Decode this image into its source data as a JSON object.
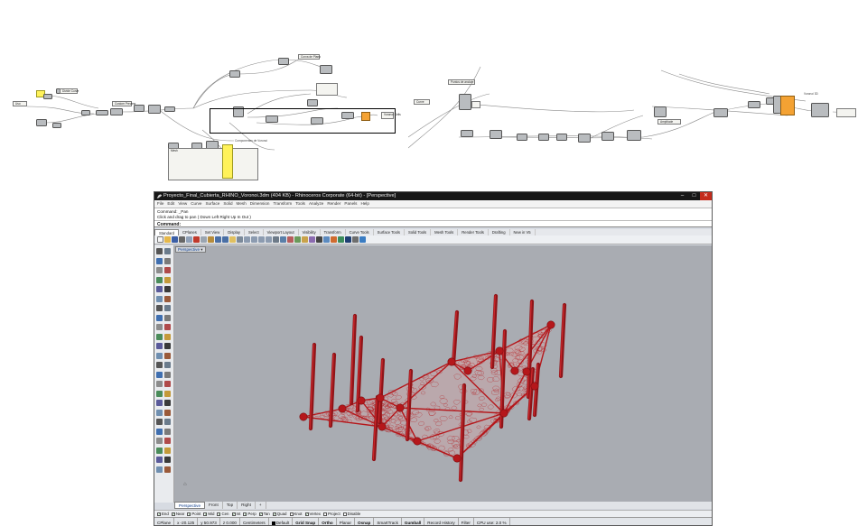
{
  "grasshopper_left": {
    "panels": [
      "Uso",
      "Divide Curve",
      "Custom Preview",
      "Curva de Plano",
      "Voronoi Cells",
      "Mesh"
    ],
    "highlight_label": "Componentes de Voronoi"
  },
  "grasshopper_right": {
    "panels": [
      "Curve",
      "Amplitude"
    ],
    "search_label": "Puntos de anclaje",
    "output_label": "Voronoi 3D"
  },
  "rhino": {
    "title": "Proyecto_Final_Cubierta_RHINO_Voronoi.3dm (404 KB) - Rhinoceros Corporate (64-bit) - [Perspective]",
    "menu": [
      "File",
      "Edit",
      "View",
      "Curve",
      "Surface",
      "Solid",
      "Mesh",
      "Dimension",
      "Transform",
      "Tools",
      "Analyze",
      "Render",
      "Panels",
      "Help"
    ],
    "command_history": [
      "Command: _Pan",
      "Click and drag to pan ( Down  Left  Right  Up  In  Out )"
    ],
    "command_prompt": "Command:",
    "toolbar_tabs": [
      "Standard",
      "CPlanes",
      "Set View",
      "Display",
      "Select",
      "Viewport Layout",
      "Visibility",
      "Transform",
      "Curve Tools",
      "Surface Tools",
      "Solid Tools",
      "Mesh Tools",
      "Render Tools",
      "Drafting",
      "New in V5"
    ],
    "viewport_title": "Perspective",
    "view_tabs": [
      "Perspective",
      "Front",
      "Top",
      "Right",
      "+"
    ],
    "osnaps": [
      {
        "label": "End",
        "checked": true
      },
      {
        "label": "Near",
        "checked": true
      },
      {
        "label": "Point",
        "checked": true
      },
      {
        "label": "Mid",
        "checked": true
      },
      {
        "label": "Cen",
        "checked": true
      },
      {
        "label": "Int",
        "checked": true
      },
      {
        "label": "Perp",
        "checked": true
      },
      {
        "label": "Tan",
        "checked": true
      },
      {
        "label": "Quad",
        "checked": true
      },
      {
        "label": "Knot",
        "checked": false
      },
      {
        "label": "Vertex",
        "checked": true
      },
      {
        "label": "Project",
        "checked": false
      },
      {
        "label": "Disable",
        "checked": false
      }
    ],
    "status": {
      "cplane": "CPlane",
      "x": "x -20.125",
      "y": "y 50.973",
      "z": "z 0.000",
      "units": "Centimeters",
      "layer": "Default",
      "grid_snap": "Grid Snap",
      "ortho": "Ortho",
      "planar": "Planar",
      "osnap": "Osnap",
      "smarttrack": "SmartTrack",
      "gumball": "Gumball",
      "record_history": "Record History",
      "filter": "Filter",
      "cpu": "CPU use: 2.0 %"
    },
    "colors": {
      "model": "#b5171b",
      "viewport_bg": "#a9acb2"
    }
  }
}
